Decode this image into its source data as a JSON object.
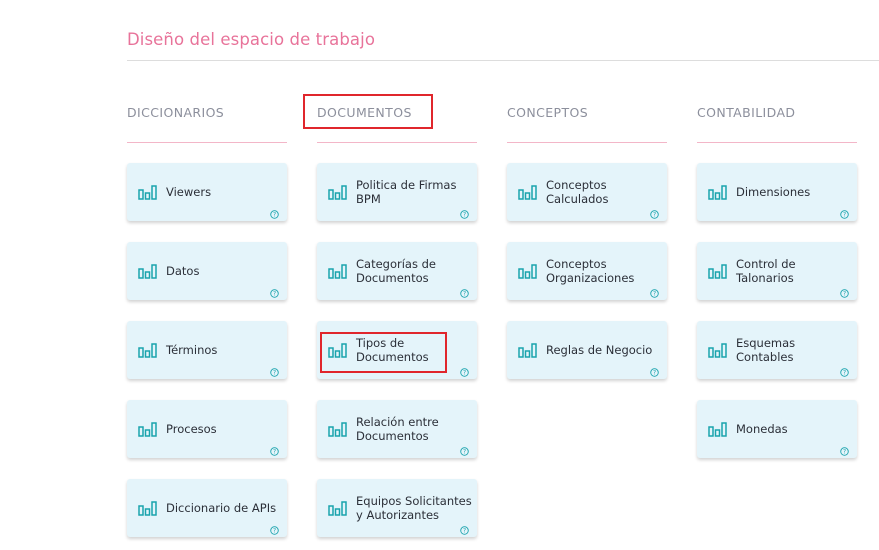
{
  "page": {
    "title": "Diseño del espacio de trabajo"
  },
  "colors": {
    "accent_pink": "#e8739a",
    "tile_bg": "#e4f4fa",
    "icon_teal": "#1aa3ad",
    "highlight_red": "#e0262c"
  },
  "columns": [
    {
      "heading": "DICCIONARIOS",
      "items": [
        {
          "label": "Viewers",
          "icon": "bar-chart-icon"
        },
        {
          "label": "Datos",
          "icon": "bar-chart-icon"
        },
        {
          "label": "Términos",
          "icon": "bar-chart-icon"
        },
        {
          "label": "Procesos",
          "icon": "bar-chart-icon"
        },
        {
          "label": "Diccionario de APIs",
          "icon": "bar-chart-icon"
        }
      ]
    },
    {
      "heading": "DOCUMENTOS",
      "items": [
        {
          "label": "Politica de Firmas BPM",
          "icon": "bar-chart-icon"
        },
        {
          "label": "Categorías de Documentos",
          "icon": "bar-chart-icon"
        },
        {
          "label": "Tipos de Documentos",
          "icon": "bar-chart-icon"
        },
        {
          "label": "Relación entre Documentos",
          "icon": "bar-chart-icon"
        },
        {
          "label": "Equipos Solicitantes y Autorizantes",
          "icon": "bar-chart-icon"
        }
      ]
    },
    {
      "heading": "CONCEPTOS",
      "items": [
        {
          "label": "Conceptos Calculados",
          "icon": "bar-chart-icon"
        },
        {
          "label": "Conceptos Organizaciones",
          "icon": "bar-chart-icon"
        },
        {
          "label": "Reglas de Negocio",
          "icon": "bar-chart-icon"
        }
      ]
    },
    {
      "heading": "CONTABILIDAD",
      "items": [
        {
          "label": "Dimensiones",
          "icon": "bar-chart-icon"
        },
        {
          "label": "Control de Talonarios",
          "icon": "bar-chart-icon"
        },
        {
          "label": "Esquemas Contables",
          "icon": "bar-chart-icon"
        },
        {
          "label": "Monedas",
          "icon": "bar-chart-icon"
        }
      ]
    }
  ]
}
